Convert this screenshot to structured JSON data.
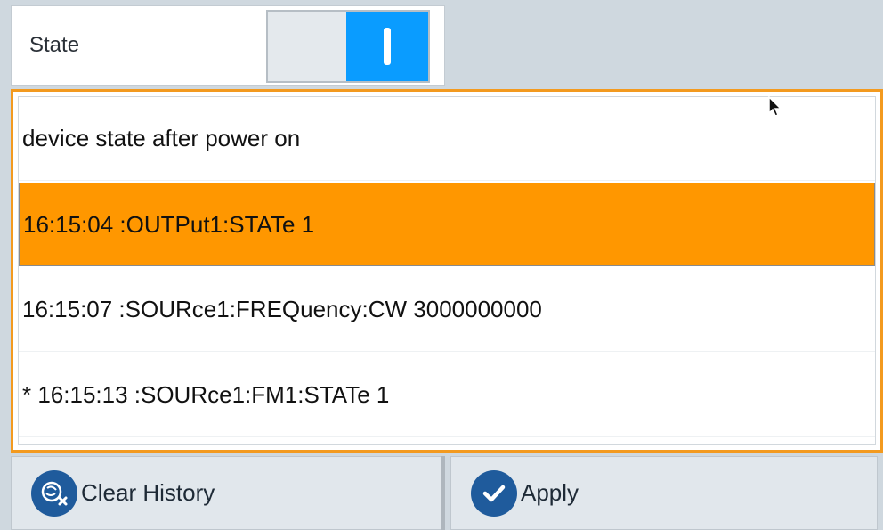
{
  "state": {
    "label": "State",
    "toggle_on": true
  },
  "history": {
    "items": [
      {
        "text": "device state after power on",
        "selected": false
      },
      {
        "text": "16:15:04 :OUTPut1:STATe 1",
        "selected": true
      },
      {
        "text": "16:15:07 :SOURce1:FREQuency:CW 3000000000",
        "selected": false
      },
      {
        "text": "* 16:15:13 :SOURce1:FM1:STATe 1",
        "selected": false
      }
    ]
  },
  "buttons": {
    "clear_history": {
      "label": "Clear History",
      "icon": "clear-history-icon"
    },
    "apply": {
      "label": "Apply",
      "icon": "checkmark-icon"
    }
  },
  "colors": {
    "accent_orange": "#ff9700",
    "frame_orange": "#f39a1f",
    "toggle_blue": "#0a9cff",
    "icon_blue": "#1f5b9c"
  }
}
